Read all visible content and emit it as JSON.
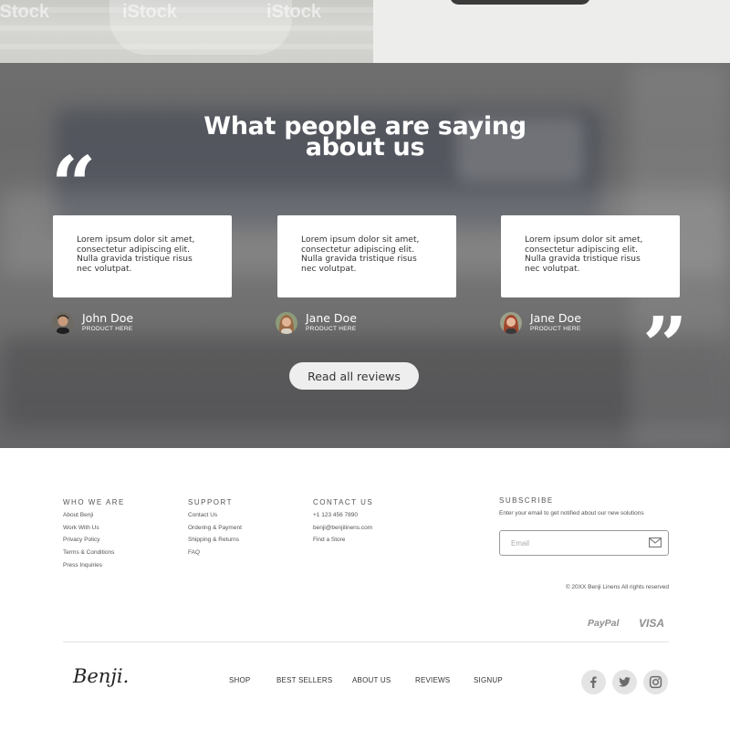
{
  "top_photo": {
    "watermarks": [
      "iStock",
      "iStock",
      "iStock"
    ]
  },
  "testimonials": {
    "title_line1": "What people are saying",
    "title_line2": "about us",
    "quote_open": "“",
    "quote_close": "”",
    "cards": [
      {
        "text": "Lorem ipsum dolor sit amet, consectetur adipiscing elit. Nulla gravida tristique risus nec volutpat.",
        "name": "John Doe",
        "product": "PRODUCT HERE"
      },
      {
        "text": "Lorem ipsum dolor sit amet, consectetur adipiscing elit. Nulla gravida tristique risus nec volutpat.",
        "name": "Jane Doe",
        "product": "PRODUCT HERE"
      },
      {
        "text": "Lorem ipsum dolor sit amet, consectetur adipiscing elit. Nulla gravida tristique risus nec volutpat.",
        "name": "Jane Doe",
        "product": "PRODUCT HERE"
      }
    ],
    "read_all_label": "Read all reviews"
  },
  "footer": {
    "who_we_are": {
      "title": "WHO WE ARE",
      "links": [
        "About Benji",
        "Work With Us",
        "Privacy Policy",
        "Terms & Conditions",
        "Press Inquiries"
      ]
    },
    "support": {
      "title": "SUPPORT",
      "links": [
        "Contact Us",
        "Ordering & Payment",
        "Shipping & Returns",
        "FAQ"
      ]
    },
    "contact": {
      "title": "CONTACT US",
      "links": [
        "+1 123 456 7890",
        "benji@benjilinens.com",
        "Find a Store"
      ]
    },
    "subscribe": {
      "title": "SUBSCRIBE",
      "description": "Enter your email to get notified about our new solutions",
      "email_placeholder": "Email"
    },
    "copyright": "© 20XX Benji Linens All rights reserved",
    "payments": [
      "PayPal",
      "VISA"
    ],
    "logo": "Benji.",
    "nav": [
      "SHOP",
      "BEST SELLERS",
      "ABOUT US",
      "REVIEWS",
      "SIGNUP"
    ],
    "social_icons": [
      "facebook-icon",
      "twitter-icon",
      "instagram-icon"
    ]
  },
  "colors": {
    "overlay": "#6e6e6e",
    "card_bg": "#ffffff",
    "button_bg": "#eeeeee",
    "social_bg": "#e4e4e4"
  }
}
